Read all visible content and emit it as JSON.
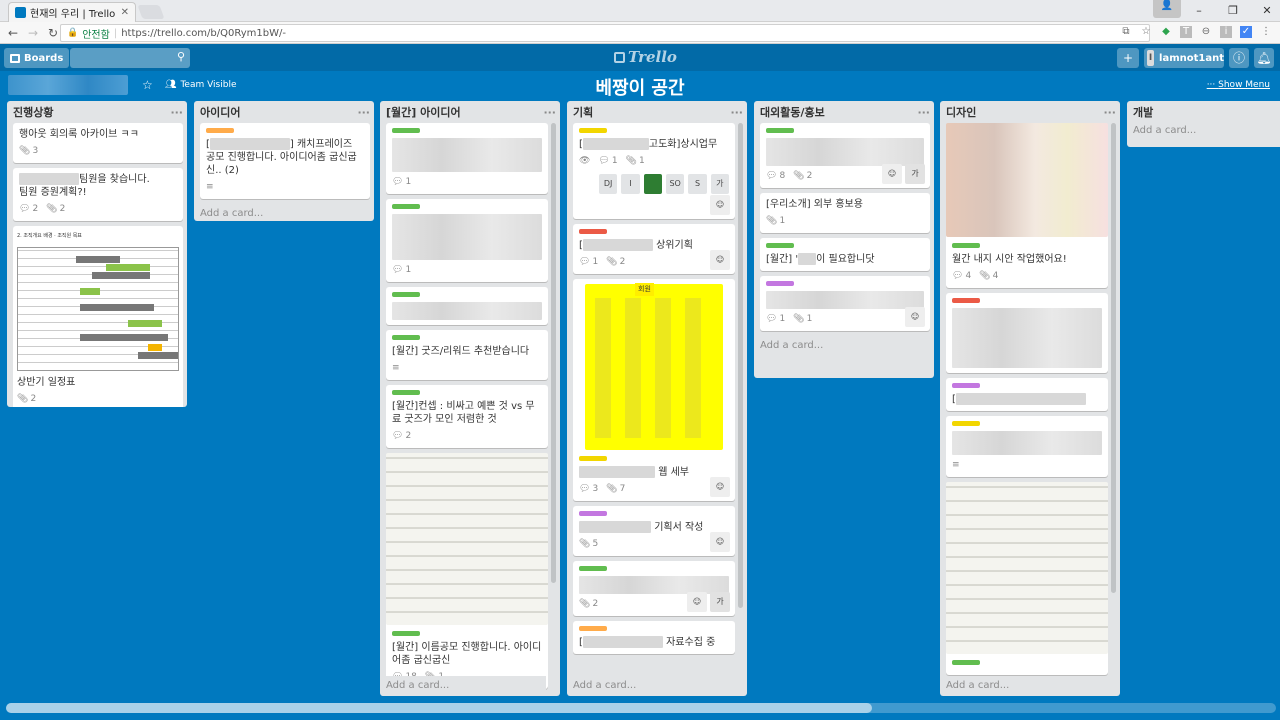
{
  "browser": {
    "tab_title": "현재의 우리 | Trello",
    "secure_label": "안전함",
    "url": "https://trello.com/b/Q0Rym1bW/-"
  },
  "header": {
    "boards_label": "Boards",
    "logo_text": "Trello",
    "username": "lamnot1ant",
    "user_initial": "I"
  },
  "board": {
    "title": "베짱이 공간",
    "visibility": "Team Visible",
    "show_menu": "Show Menu"
  },
  "add_card": "Add a card...",
  "lists": {
    "l1": {
      "title": "진행상황",
      "c1": {
        "text": "행아웃 회의록 아카이브 ㅋㅋ",
        "attach": "3"
      },
      "c2": {
        "text": "팀원을 찾습니다.",
        "text2": "팀원 증원계획?!",
        "comments": "2",
        "attach": "2"
      },
      "c3": {
        "text": "상반기 일정표",
        "attach": "2",
        "img_title": "2. 조직개요 배경 · 조직원 목표"
      }
    },
    "l2": {
      "title": "아이디어",
      "c1": {
        "text": "] 캐치프레이즈 공모 진행합니다. 아이디어좀 굽신굽신.. (2)",
        "prefix": "["
      }
    },
    "l3": {
      "title": "[월간] 아이디어",
      "c1": {
        "comments": "1"
      },
      "c2": {
        "comments": "1"
      },
      "c4": {
        "text": "[월간] 굿즈/리워드 추천받습니다"
      },
      "c5": {
        "text": "[월간]컨셉 : 비싸고 예쁜 것 vs 무료 굿즈가 모인 저렴한 것",
        "comments": "2"
      },
      "c6": {
        "text": "[월간] 이름공모 진행합니다. 아이디어좀 굽신굽신",
        "comments": "18",
        "attach": "1"
      }
    },
    "l4": {
      "title": "기획",
      "c1": {
        "text": "고도화]상시업무",
        "prefix": "[",
        "comments": "1",
        "attach": "1",
        "chips": [
          "DJ",
          "I",
          "SO",
          "S",
          "가"
        ]
      },
      "c2": {
        "text": "상위기획",
        "prefix": "[",
        "comments": "1",
        "attach": "2"
      },
      "c3": {
        "text": "웹 세부",
        "comments": "3",
        "attach": "7",
        "sticker": "회원"
      },
      "c4": {
        "text": "기획서 작성",
        "attach": "5"
      },
      "c5": {
        "attach": "2",
        "member": "가"
      },
      "c6": {
        "text": "자료수집 중",
        "prefix": "["
      }
    },
    "l5": {
      "title": "대외활동/홍보",
      "c1": {
        "comments": "8",
        "attach": "2",
        "member": "가"
      },
      "c2": {
        "text": "[우리소개] 외부 홍보용",
        "attach": "1"
      },
      "c3": {
        "text": "[월간] '",
        "text2": "이 필요합니닷"
      },
      "c4": {
        "comments": "1",
        "attach": "1"
      }
    },
    "l6": {
      "title": "디자인",
      "c1": {
        "text": "월간 내지 시안 작업했어요!",
        "comments": "4",
        "attach": "4"
      },
      "c3": {
        "prefix": "["
      }
    },
    "l7": {
      "title": "개발"
    }
  },
  "colors": {
    "board_bg": "#0079bf",
    "header_bg": "#026aa7",
    "list_bg": "#e2e4e6"
  }
}
